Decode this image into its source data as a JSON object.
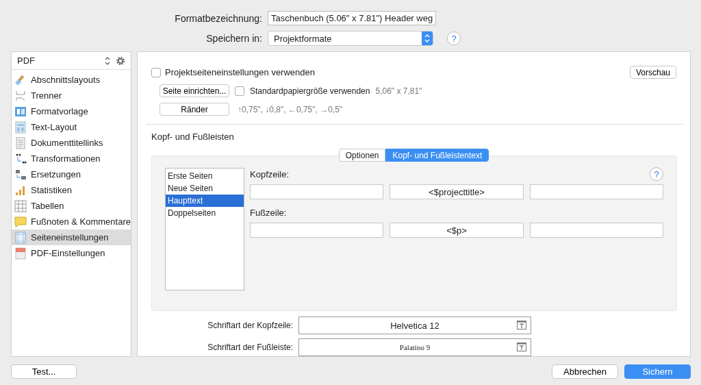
{
  "header": {
    "name_label": "Formatbezeichnung:",
    "name_value": "Taschenbuch (5.06\" x 7.81\") Header weg",
    "save_label": "Speichern in:",
    "save_value": "Projektformate",
    "help": "?"
  },
  "sidebar": {
    "format": "PDF",
    "items": [
      {
        "label": "Abschnittslayouts",
        "selected": false
      },
      {
        "label": "Trenner",
        "selected": false
      },
      {
        "label": "Formatvorlage",
        "selected": false
      },
      {
        "label": "Text-Layout",
        "selected": false
      },
      {
        "label": "Dokumenttitellinks",
        "selected": false
      },
      {
        "label": "Transformationen",
        "selected": false
      },
      {
        "label": "Ersetzungen",
        "selected": false
      },
      {
        "label": "Statistiken",
        "selected": false
      },
      {
        "label": "Tabellen",
        "selected": false
      },
      {
        "label": "Fußnoten & Kommentare",
        "selected": false
      },
      {
        "label": "Seiteneinstellungen",
        "selected": true
      },
      {
        "label": "PDF-Einstellungen",
        "selected": false
      }
    ]
  },
  "page": {
    "use_project": {
      "label": "Projektseiteneinstellungen verwenden",
      "checked": false
    },
    "preview_button": "Vorschau",
    "setup_button": "Seite einrichten...",
    "standard_paper": {
      "label": "Standardpapiergröße verwenden",
      "checked": false
    },
    "paper_size": "5,06\" x 7,81\"",
    "margins_button": "Ränder",
    "margins": "↑0,75\", ↓0,8\", ←0,75\", →0,5\""
  },
  "headers_footers": {
    "title": "Kopf- und Fußleisten",
    "tabs": [
      {
        "label": "Optionen",
        "selected": false
      },
      {
        "label": "Kopf- und Fußleistentext",
        "selected": true
      }
    ],
    "page_types": [
      {
        "label": "Erste Seiten",
        "selected": false
      },
      {
        "label": "Neue Seiten",
        "selected": false
      },
      {
        "label": "Haupttext",
        "selected": true
      },
      {
        "label": "Doppelseiten",
        "selected": false
      }
    ],
    "help": "?",
    "header_label": "Kopfzeile:",
    "header_center": "<$projecttitle>",
    "footer_label": "Fußzeile:",
    "footer_center": "<$p>"
  },
  "fonts": [
    {
      "label": "Schriftart der Kopfzeile:",
      "value": "Helvetica 12",
      "kind": "sans"
    },
    {
      "label": "Schriftart der Fußleiste:",
      "value": "Palatino 9",
      "kind": "serif"
    }
  ],
  "buttons": {
    "test": "Test...",
    "cancel": "Abbrechen",
    "save": "Sichern"
  }
}
